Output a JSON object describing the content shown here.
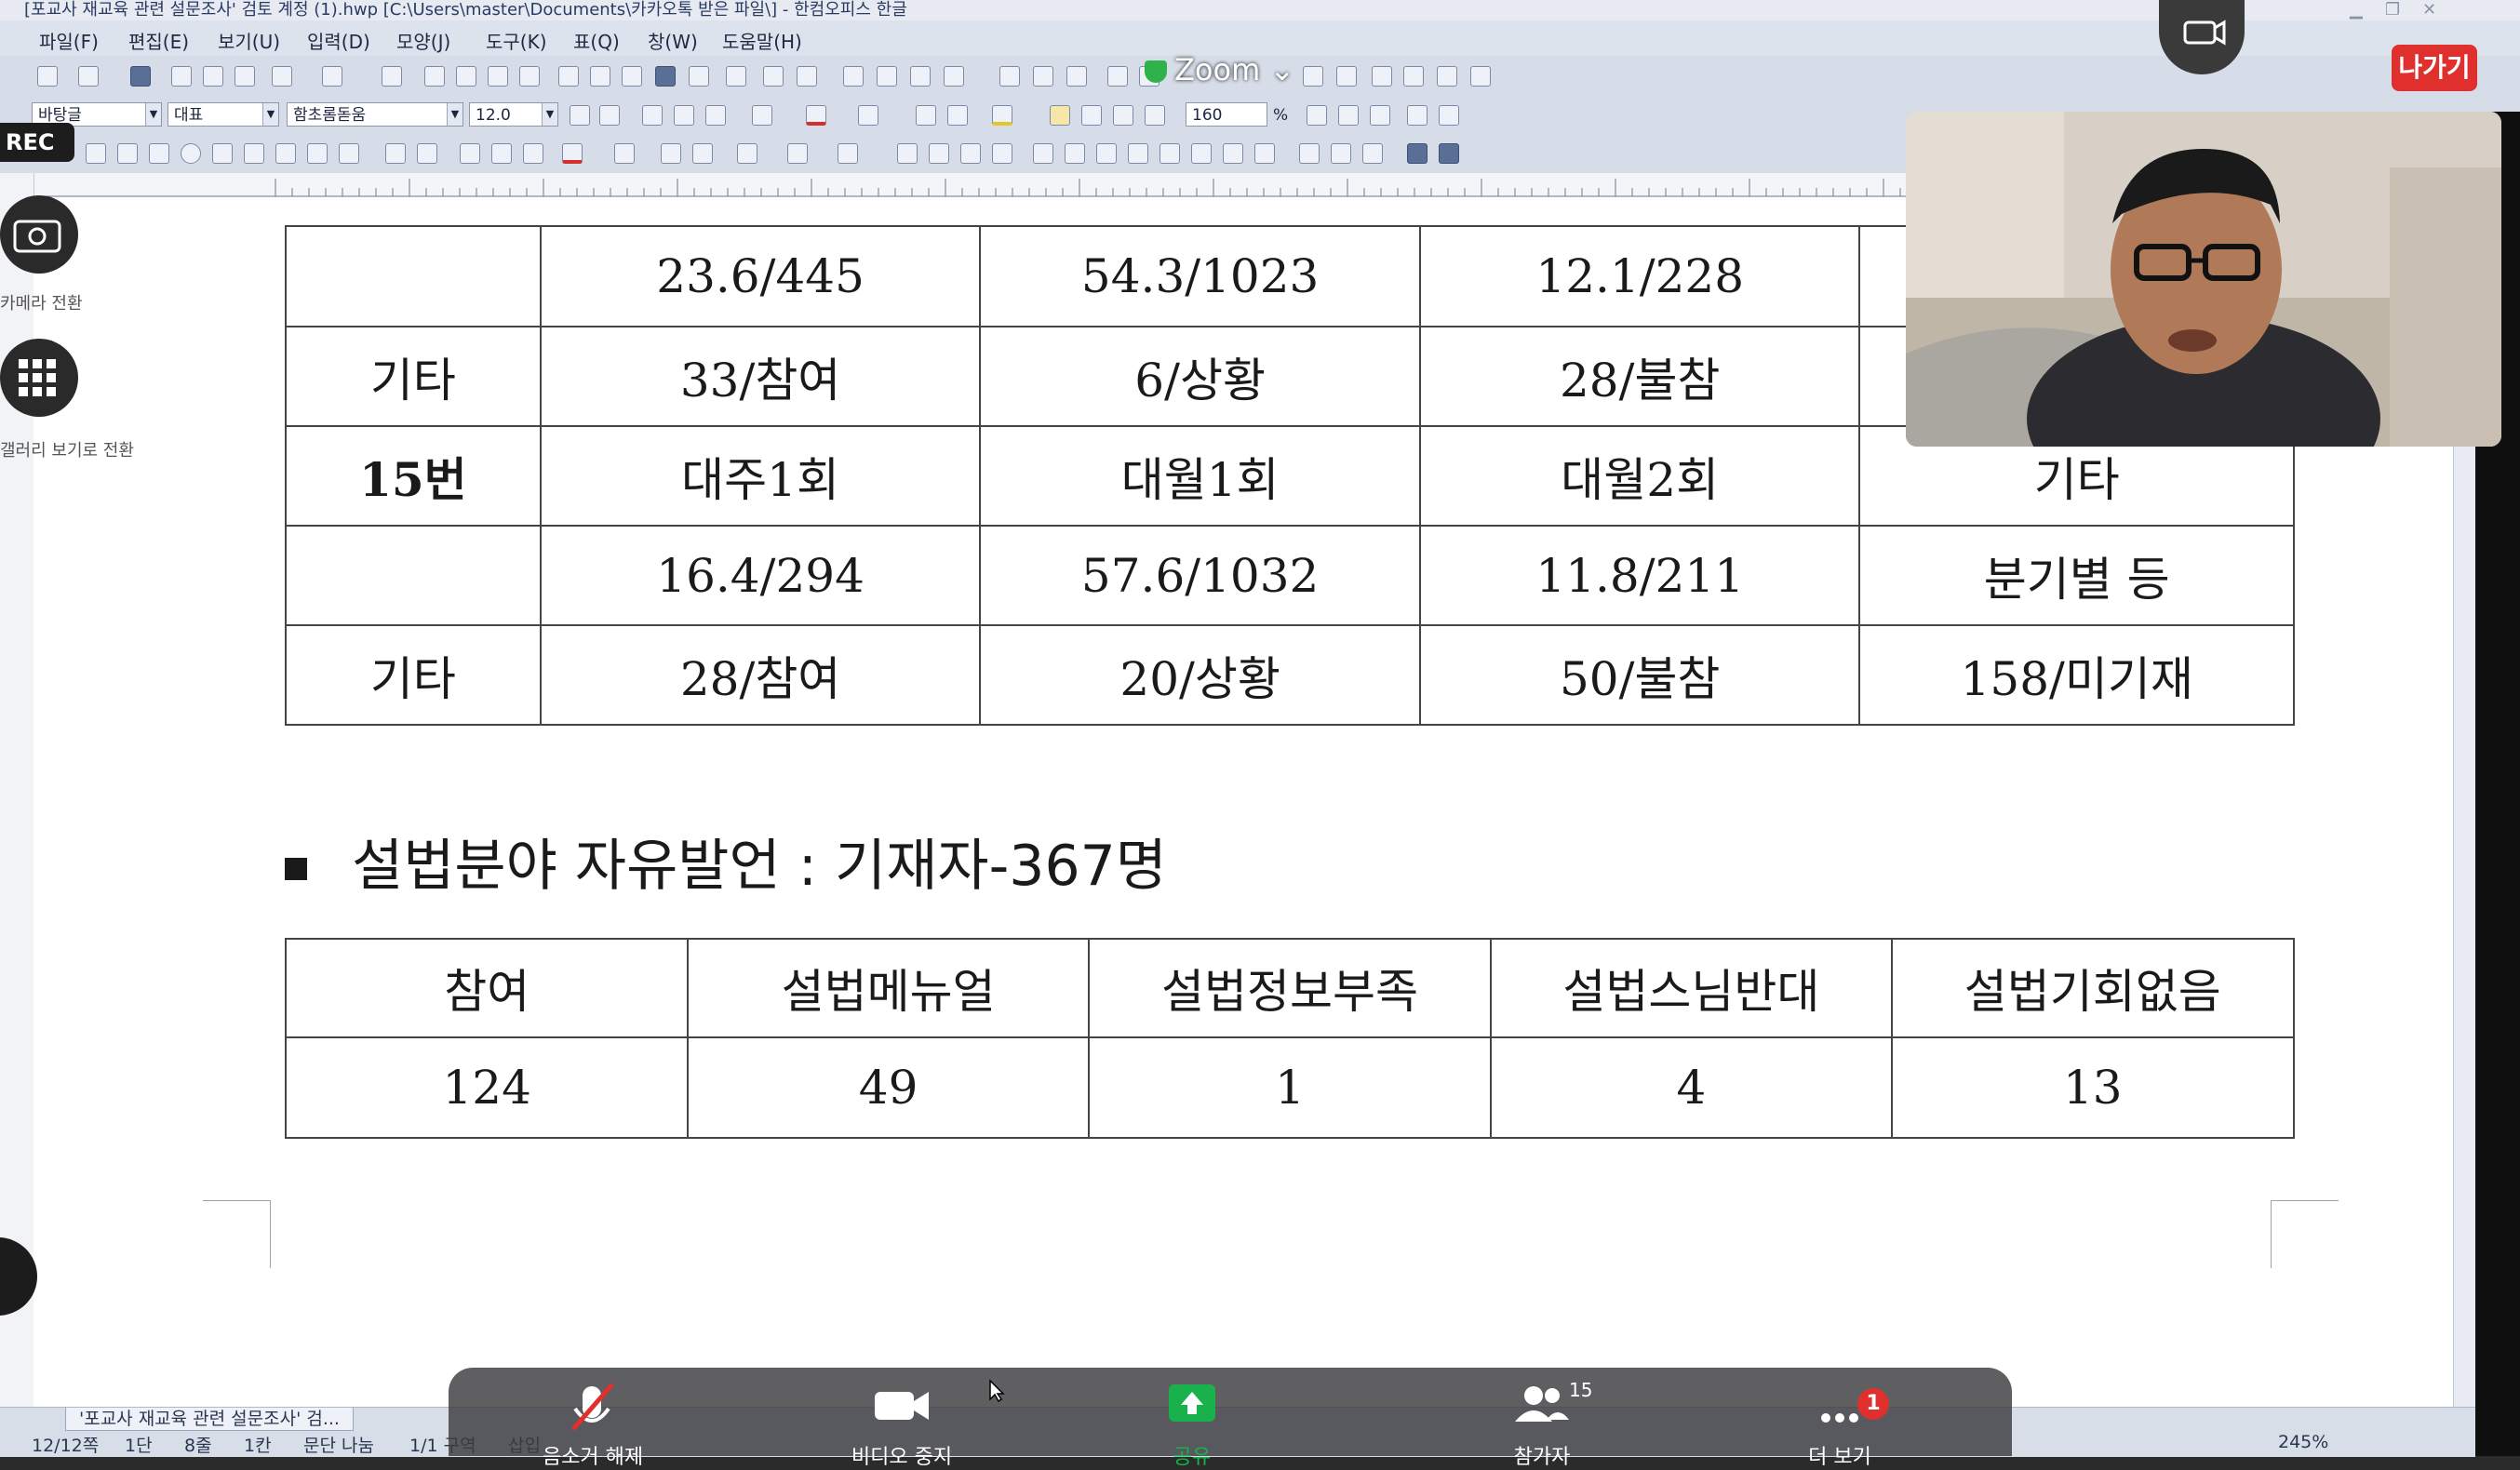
{
  "window": {
    "title": "[포교사 재교육 관련 설문조사' 검토 계정 (1).hwp [C:\\Users\\master\\Documents\\카카오톡 받은 파일\\] - 한컴오피스 한글"
  },
  "menu": [
    "파일(F)",
    "편집(E)",
    "보기(U)",
    "입력(D)",
    "모양(J)",
    "도구(K)",
    "표(Q)",
    "창(W)",
    "도움말(H)"
  ],
  "format_bar": {
    "style": "바탕글",
    "font_kind": "대표",
    "font": "함초롬돋움",
    "font_size": "12.0",
    "line_spacing": "160",
    "line_spacing_unit": "%"
  },
  "document": {
    "table1": {
      "rows": [
        [
          "",
          "23.6/445",
          "54.3/1023",
          "12.1/228",
          ""
        ],
        [
          "기타",
          "33/참여",
          "6/상황",
          "28/불참",
          ""
        ],
        [
          "15번",
          "대주1회",
          "대월1회",
          "대월2회",
          "기타"
        ],
        [
          "",
          "16.4/294",
          "57.6/1032",
          "11.8/211",
          "분기별 등"
        ],
        [
          "기타",
          "28/참여",
          "20/상황",
          "50/불참",
          "158/미기재"
        ]
      ]
    },
    "heading": "설법분야 자유발언 : 기재자-367명",
    "table2": {
      "headers": [
        "참여",
        "설법메뉴얼",
        "설법정보부족",
        "설법스님반대",
        "설법기회없음"
      ],
      "values": [
        "124",
        "49",
        "1",
        "4",
        "13"
      ]
    }
  },
  "statusbar": {
    "doc_tab": "'포교사 재교육 관련 설문조사' 검...",
    "page": "12/12쪽",
    "section": "1단",
    "line": "8줄",
    "column": "1칸",
    "split": "문단 나눔",
    "area": "1/1 구역",
    "mode": "삽입",
    "zoom": "245%"
  },
  "zoom_meeting": {
    "app_label": "Zoom",
    "leave_label": "나가기",
    "rec_label": "REC",
    "camera_switch_label": "카메라 전환",
    "gallery_label": "갤러리 보기로 전환",
    "controls": [
      {
        "label": "음소거 해제",
        "icon": "mic-muted-icon"
      },
      {
        "label": "비디오 중지",
        "icon": "video-camera-icon"
      },
      {
        "label": "공유",
        "icon": "share-screen-icon"
      },
      {
        "label": "참가자",
        "icon": "participants-icon",
        "count": "15"
      },
      {
        "label": "더 보기",
        "icon": "more-icon",
        "badge": "1"
      }
    ],
    "accent_color": "#e0302e",
    "share_color": "#19b14b"
  }
}
